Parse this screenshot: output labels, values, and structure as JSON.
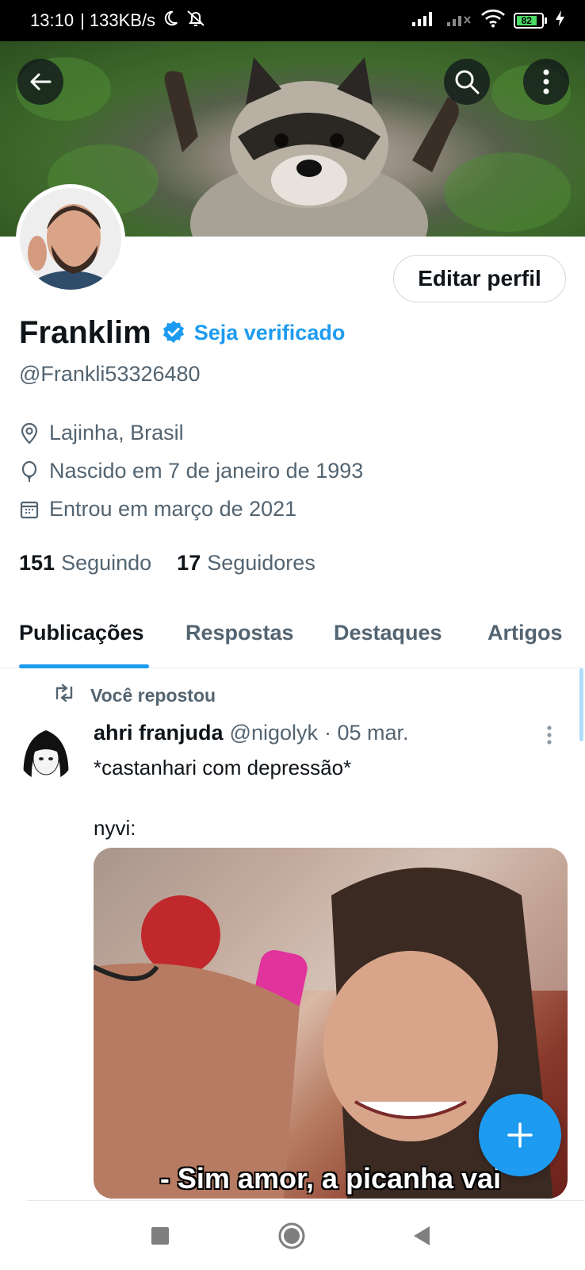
{
  "status_bar": {
    "time": "13:10",
    "network_speed": "| 133KB/s",
    "battery_level": "82",
    "icons": [
      "moon-icon",
      "mute-icon",
      "signal-icon",
      "wifi-icon",
      "battery-icon",
      "charging-icon"
    ]
  },
  "profile": {
    "name": "Franklim",
    "get_verified_label": "Seja verificado",
    "handle": "@Frankli53326480",
    "edit_profile_label": "Editar perfil",
    "location": "Lajinha, Brasil",
    "birth": "Nascido em 7 de janeiro de 1993",
    "joined": "Entrou em março de 2021",
    "following_count": "151",
    "following_label": "Seguindo",
    "followers_count": "17",
    "followers_label": "Seguidores"
  },
  "tabs": [
    {
      "label": "Publicações",
      "active": true
    },
    {
      "label": "Respostas",
      "active": false
    },
    {
      "label": "Destaques",
      "active": false
    },
    {
      "label": "Artigos",
      "active": false
    }
  ],
  "post": {
    "repost_label": "Você repostou",
    "author": "ahri franjuda",
    "author_handle": "@nigolyk",
    "date": "· 05 mar.",
    "text_line1": "*castanhari com depressão*",
    "text_line2": "nyvi:",
    "media_caption": "- Sim amor, a picanha vai"
  },
  "colors": {
    "accent": "#1d9bf0",
    "text_primary": "#0f1419",
    "text_secondary": "#536471"
  }
}
